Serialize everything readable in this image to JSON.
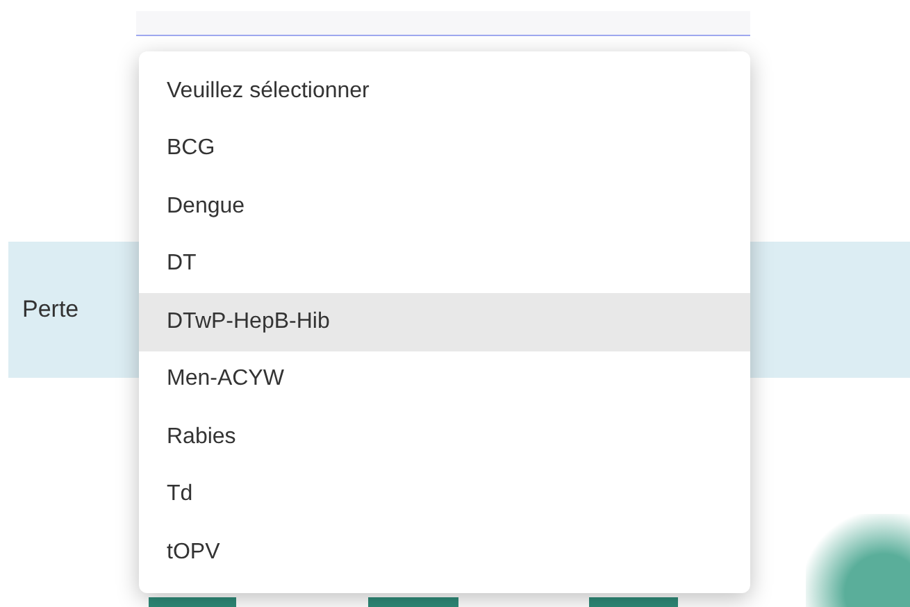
{
  "row_label": "Perte",
  "menu": {
    "options": [
      {
        "label": "Veuillez sélectionner",
        "selected": false
      },
      {
        "label": "BCG",
        "selected": false
      },
      {
        "label": "Dengue",
        "selected": false
      },
      {
        "label": "DT",
        "selected": false
      },
      {
        "label": "DTwP-HepB-Hib",
        "selected": true
      },
      {
        "label": "Men-ACYW",
        "selected": false
      },
      {
        "label": "Rabies",
        "selected": false
      },
      {
        "label": "Td",
        "selected": false
      },
      {
        "label": "tOPV",
        "selected": false
      }
    ]
  }
}
